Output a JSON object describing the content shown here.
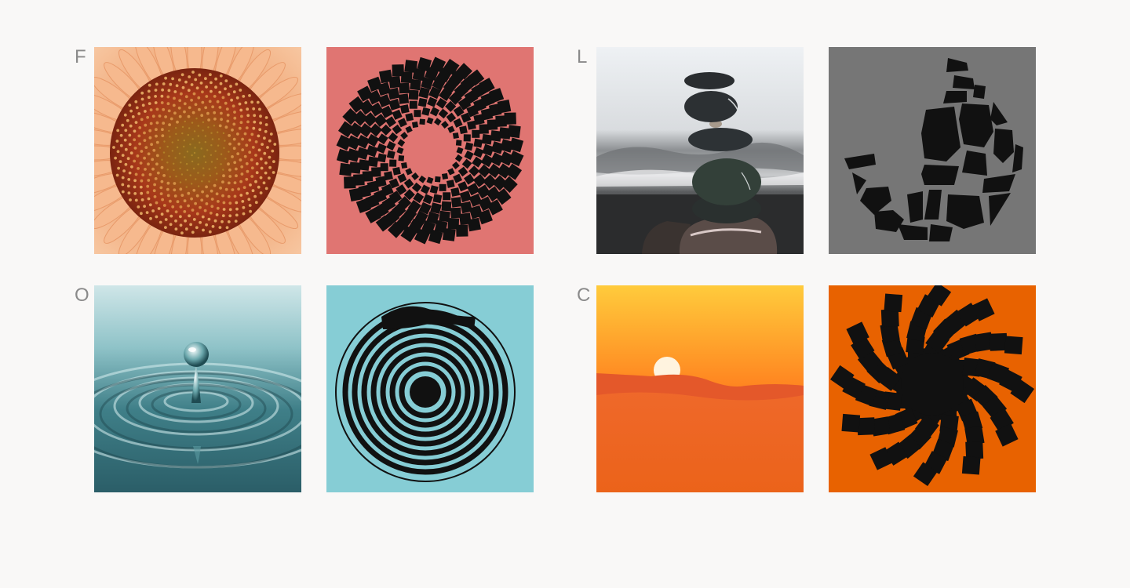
{
  "pairs": [
    {
      "letter": "F",
      "photo": "sunflower",
      "pattern": "checker-spiral",
      "pattern_bg": "#e07572"
    },
    {
      "letter": "L",
      "photo": "stacked-stones",
      "pattern": "stone-mosaic",
      "pattern_bg": "#767676"
    },
    {
      "letter": "O",
      "photo": "water-drop",
      "pattern": "ripple-rings",
      "pattern_bg": "#86cdd5"
    },
    {
      "letter": "C",
      "photo": "desert-sunset",
      "pattern": "pinwheel-sun",
      "pattern_bg": "#e86200"
    }
  ],
  "colors": {
    "page_bg": "#f9f8f7",
    "letter": "#8a8a8a",
    "ink": "#111111"
  }
}
